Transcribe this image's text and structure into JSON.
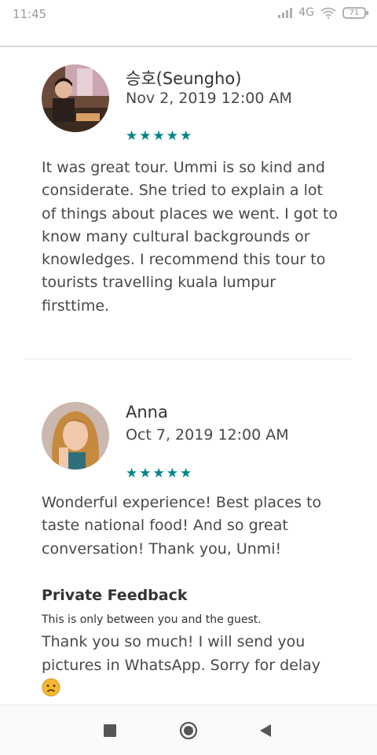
{
  "status": {
    "time": "11:45",
    "network": "4G",
    "battery": "71"
  },
  "reviews": [
    {
      "name": "승호(Seungho)",
      "date": "Nov 2, 2019 12:00 AM",
      "rating": 5,
      "text": "It was great tour. Ummi is so kind and considerate. She tried to explain a lot of things about places we went. I got to know many cultural backgrounds or knowledges. I recommend this tour to tourists travelling kuala lumpur firsttime."
    },
    {
      "name": "Anna",
      "date": "Oct 7, 2019 12:00 AM",
      "rating": 5,
      "text": "Wonderful experience! Best places to taste national food! And so great conversation! Thank you, Unmi!"
    }
  ],
  "private_feedback": {
    "title": "Private Feedback",
    "note": "This is only between you and the guest.",
    "text": "Thank you so much! I will send you pictures in WhatsApp. Sorry for delay"
  },
  "colors": {
    "star": "#008489",
    "text": "#484848"
  },
  "icons": {
    "star": "★",
    "nav_recents": "square",
    "nav_home": "circle",
    "nav_back": "triangle"
  }
}
